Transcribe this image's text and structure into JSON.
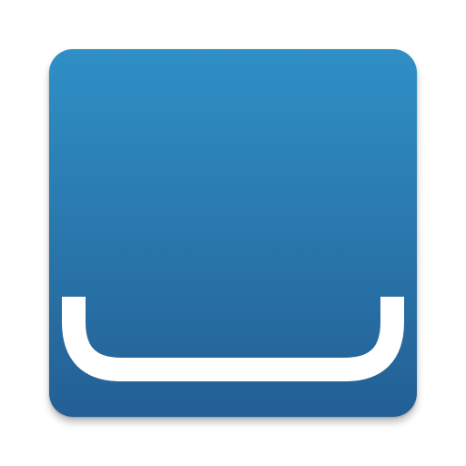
{
  "icon": {
    "name": "smile-tray-icon",
    "background_top": "#2f90c6",
    "background_bottom": "#235f94",
    "glyph_color": "#ffffff"
  }
}
